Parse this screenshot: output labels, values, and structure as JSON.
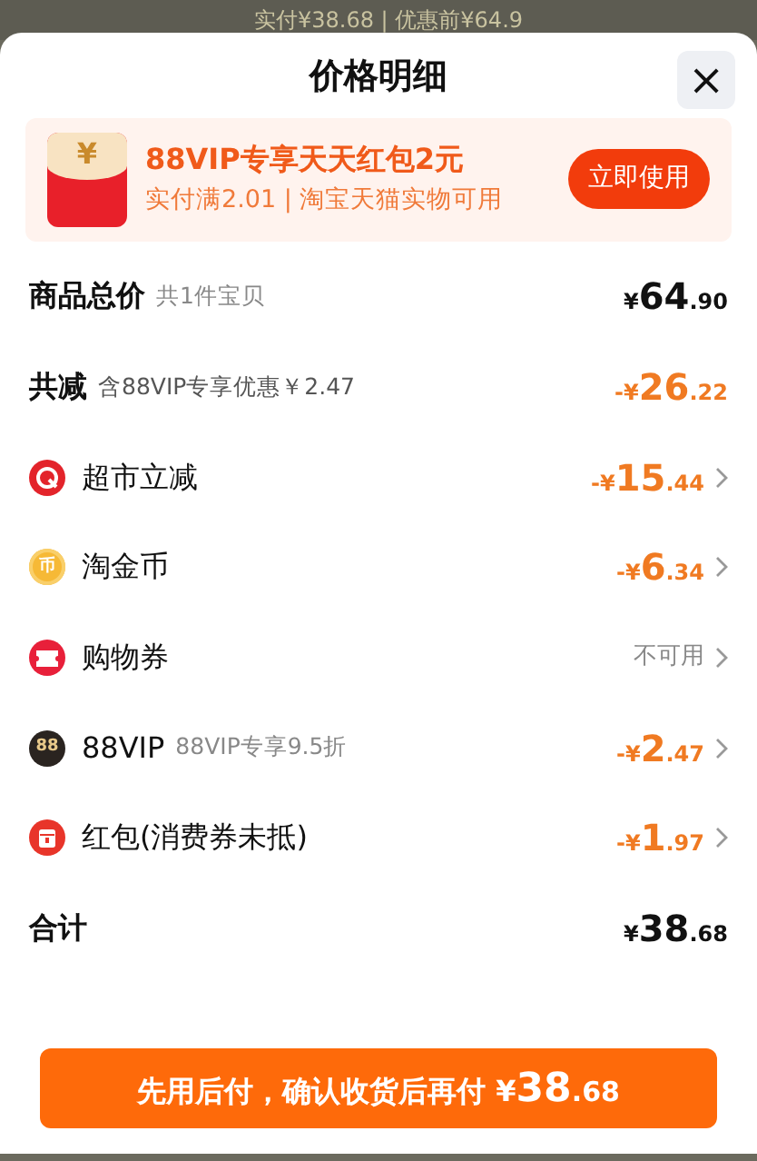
{
  "backdrop": {
    "text": "实付¥38.68 | 优惠前¥64.9"
  },
  "sheet": {
    "title": "价格明细",
    "close": "×"
  },
  "banner": {
    "icon_text": "¥",
    "title": "88VIP专享天天红包2元",
    "subtitle": "实付满2.01 | 淘宝天猫实物可用",
    "button": "立即使用"
  },
  "rows": [
    {
      "kind": "heading",
      "label": "商品总价",
      "note": "共1件宝贝",
      "amount": "¥64.90"
    },
    {
      "kind": "heading",
      "label": "共减",
      "note": "含88VIP专享优惠￥2.47",
      "amount": "-¥26.22",
      "discount": true
    },
    {
      "kind": "supermarket",
      "label": "超市立减",
      "amount": "-¥15.44",
      "available": true
    },
    {
      "kind": "coin",
      "icon_text": "币",
      "label": "淘金币",
      "amount": "-¥6.34",
      "available": true
    },
    {
      "kind": "ticket",
      "label": "购物券",
      "amount": "不可用",
      "available": false
    },
    {
      "kind": "vip",
      "icon_text": "88",
      "label": "88VIP",
      "note": "88VIP专享9.5折",
      "amount": "-¥2.47",
      "available": true
    },
    {
      "kind": "packet",
      "label": "红包(消费券未抵)",
      "amount": "-¥1.97",
      "available": true
    },
    {
      "kind": "heading",
      "label": "合计",
      "amount": "¥38.68"
    }
  ],
  "pay_button": {
    "text": "先用后付，确认收货后再付",
    "amount": "¥38.68"
  }
}
